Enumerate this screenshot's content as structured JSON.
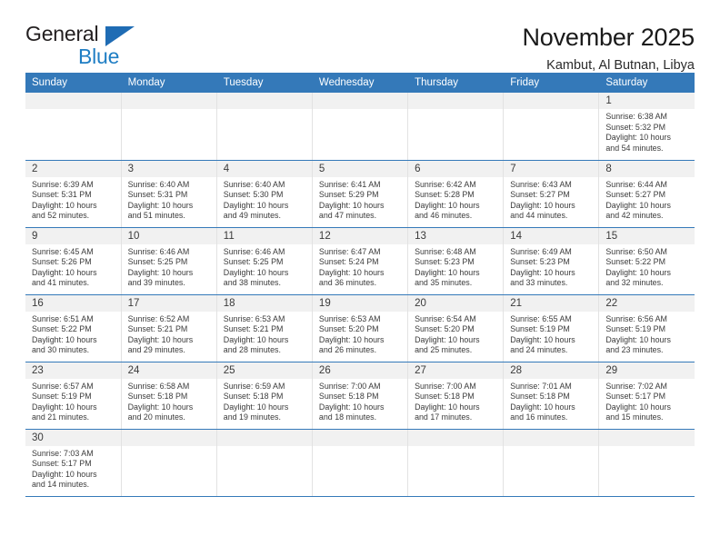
{
  "logo": {
    "word1": "General",
    "word2": "Blue",
    "triangle_color": "#1f6cb4",
    "blue_color": "#1f7ec4"
  },
  "header": {
    "title": "November 2025",
    "subtitle": "Kambut, Al Butnan, Libya"
  },
  "theme": {
    "header_band": "#3479b9",
    "daynum_strip": "#f1f1f1",
    "row_divider": "#3479b9",
    "text": "#3b3b3b"
  },
  "weekdays": [
    "Sunday",
    "Monday",
    "Tuesday",
    "Wednesday",
    "Thursday",
    "Friday",
    "Saturday"
  ],
  "weeks": [
    [
      {
        "blank": true
      },
      {
        "blank": true
      },
      {
        "blank": true
      },
      {
        "blank": true
      },
      {
        "blank": true
      },
      {
        "blank": true
      },
      {
        "day": "1",
        "sunrise": "Sunrise: 6:38 AM",
        "sunset": "Sunset: 5:32 PM",
        "daylight1": "Daylight: 10 hours",
        "daylight2": "and 54 minutes."
      }
    ],
    [
      {
        "day": "2",
        "sunrise": "Sunrise: 6:39 AM",
        "sunset": "Sunset: 5:31 PM",
        "daylight1": "Daylight: 10 hours",
        "daylight2": "and 52 minutes."
      },
      {
        "day": "3",
        "sunrise": "Sunrise: 6:40 AM",
        "sunset": "Sunset: 5:31 PM",
        "daylight1": "Daylight: 10 hours",
        "daylight2": "and 51 minutes."
      },
      {
        "day": "4",
        "sunrise": "Sunrise: 6:40 AM",
        "sunset": "Sunset: 5:30 PM",
        "daylight1": "Daylight: 10 hours",
        "daylight2": "and 49 minutes."
      },
      {
        "day": "5",
        "sunrise": "Sunrise: 6:41 AM",
        "sunset": "Sunset: 5:29 PM",
        "daylight1": "Daylight: 10 hours",
        "daylight2": "and 47 minutes."
      },
      {
        "day": "6",
        "sunrise": "Sunrise: 6:42 AM",
        "sunset": "Sunset: 5:28 PM",
        "daylight1": "Daylight: 10 hours",
        "daylight2": "and 46 minutes."
      },
      {
        "day": "7",
        "sunrise": "Sunrise: 6:43 AM",
        "sunset": "Sunset: 5:27 PM",
        "daylight1": "Daylight: 10 hours",
        "daylight2": "and 44 minutes."
      },
      {
        "day": "8",
        "sunrise": "Sunrise: 6:44 AM",
        "sunset": "Sunset: 5:27 PM",
        "daylight1": "Daylight: 10 hours",
        "daylight2": "and 42 minutes."
      }
    ],
    [
      {
        "day": "9",
        "sunrise": "Sunrise: 6:45 AM",
        "sunset": "Sunset: 5:26 PM",
        "daylight1": "Daylight: 10 hours",
        "daylight2": "and 41 minutes."
      },
      {
        "day": "10",
        "sunrise": "Sunrise: 6:46 AM",
        "sunset": "Sunset: 5:25 PM",
        "daylight1": "Daylight: 10 hours",
        "daylight2": "and 39 minutes."
      },
      {
        "day": "11",
        "sunrise": "Sunrise: 6:46 AM",
        "sunset": "Sunset: 5:25 PM",
        "daylight1": "Daylight: 10 hours",
        "daylight2": "and 38 minutes."
      },
      {
        "day": "12",
        "sunrise": "Sunrise: 6:47 AM",
        "sunset": "Sunset: 5:24 PM",
        "daylight1": "Daylight: 10 hours",
        "daylight2": "and 36 minutes."
      },
      {
        "day": "13",
        "sunrise": "Sunrise: 6:48 AM",
        "sunset": "Sunset: 5:23 PM",
        "daylight1": "Daylight: 10 hours",
        "daylight2": "and 35 minutes."
      },
      {
        "day": "14",
        "sunrise": "Sunrise: 6:49 AM",
        "sunset": "Sunset: 5:23 PM",
        "daylight1": "Daylight: 10 hours",
        "daylight2": "and 33 minutes."
      },
      {
        "day": "15",
        "sunrise": "Sunrise: 6:50 AM",
        "sunset": "Sunset: 5:22 PM",
        "daylight1": "Daylight: 10 hours",
        "daylight2": "and 32 minutes."
      }
    ],
    [
      {
        "day": "16",
        "sunrise": "Sunrise: 6:51 AM",
        "sunset": "Sunset: 5:22 PM",
        "daylight1": "Daylight: 10 hours",
        "daylight2": "and 30 minutes."
      },
      {
        "day": "17",
        "sunrise": "Sunrise: 6:52 AM",
        "sunset": "Sunset: 5:21 PM",
        "daylight1": "Daylight: 10 hours",
        "daylight2": "and 29 minutes."
      },
      {
        "day": "18",
        "sunrise": "Sunrise: 6:53 AM",
        "sunset": "Sunset: 5:21 PM",
        "daylight1": "Daylight: 10 hours",
        "daylight2": "and 28 minutes."
      },
      {
        "day": "19",
        "sunrise": "Sunrise: 6:53 AM",
        "sunset": "Sunset: 5:20 PM",
        "daylight1": "Daylight: 10 hours",
        "daylight2": "and 26 minutes."
      },
      {
        "day": "20",
        "sunrise": "Sunrise: 6:54 AM",
        "sunset": "Sunset: 5:20 PM",
        "daylight1": "Daylight: 10 hours",
        "daylight2": "and 25 minutes."
      },
      {
        "day": "21",
        "sunrise": "Sunrise: 6:55 AM",
        "sunset": "Sunset: 5:19 PM",
        "daylight1": "Daylight: 10 hours",
        "daylight2": "and 24 minutes."
      },
      {
        "day": "22",
        "sunrise": "Sunrise: 6:56 AM",
        "sunset": "Sunset: 5:19 PM",
        "daylight1": "Daylight: 10 hours",
        "daylight2": "and 23 minutes."
      }
    ],
    [
      {
        "day": "23",
        "sunrise": "Sunrise: 6:57 AM",
        "sunset": "Sunset: 5:19 PM",
        "daylight1": "Daylight: 10 hours",
        "daylight2": "and 21 minutes."
      },
      {
        "day": "24",
        "sunrise": "Sunrise: 6:58 AM",
        "sunset": "Sunset: 5:18 PM",
        "daylight1": "Daylight: 10 hours",
        "daylight2": "and 20 minutes."
      },
      {
        "day": "25",
        "sunrise": "Sunrise: 6:59 AM",
        "sunset": "Sunset: 5:18 PM",
        "daylight1": "Daylight: 10 hours",
        "daylight2": "and 19 minutes."
      },
      {
        "day": "26",
        "sunrise": "Sunrise: 7:00 AM",
        "sunset": "Sunset: 5:18 PM",
        "daylight1": "Daylight: 10 hours",
        "daylight2": "and 18 minutes."
      },
      {
        "day": "27",
        "sunrise": "Sunrise: 7:00 AM",
        "sunset": "Sunset: 5:18 PM",
        "daylight1": "Daylight: 10 hours",
        "daylight2": "and 17 minutes."
      },
      {
        "day": "28",
        "sunrise": "Sunrise: 7:01 AM",
        "sunset": "Sunset: 5:18 PM",
        "daylight1": "Daylight: 10 hours",
        "daylight2": "and 16 minutes."
      },
      {
        "day": "29",
        "sunrise": "Sunrise: 7:02 AM",
        "sunset": "Sunset: 5:17 PM",
        "daylight1": "Daylight: 10 hours",
        "daylight2": "and 15 minutes."
      }
    ],
    [
      {
        "day": "30",
        "sunrise": "Sunrise: 7:03 AM",
        "sunset": "Sunset: 5:17 PM",
        "daylight1": "Daylight: 10 hours",
        "daylight2": "and 14 minutes."
      },
      {
        "blank": true
      },
      {
        "blank": true
      },
      {
        "blank": true
      },
      {
        "blank": true
      },
      {
        "blank": true
      },
      {
        "blank": true
      }
    ]
  ]
}
